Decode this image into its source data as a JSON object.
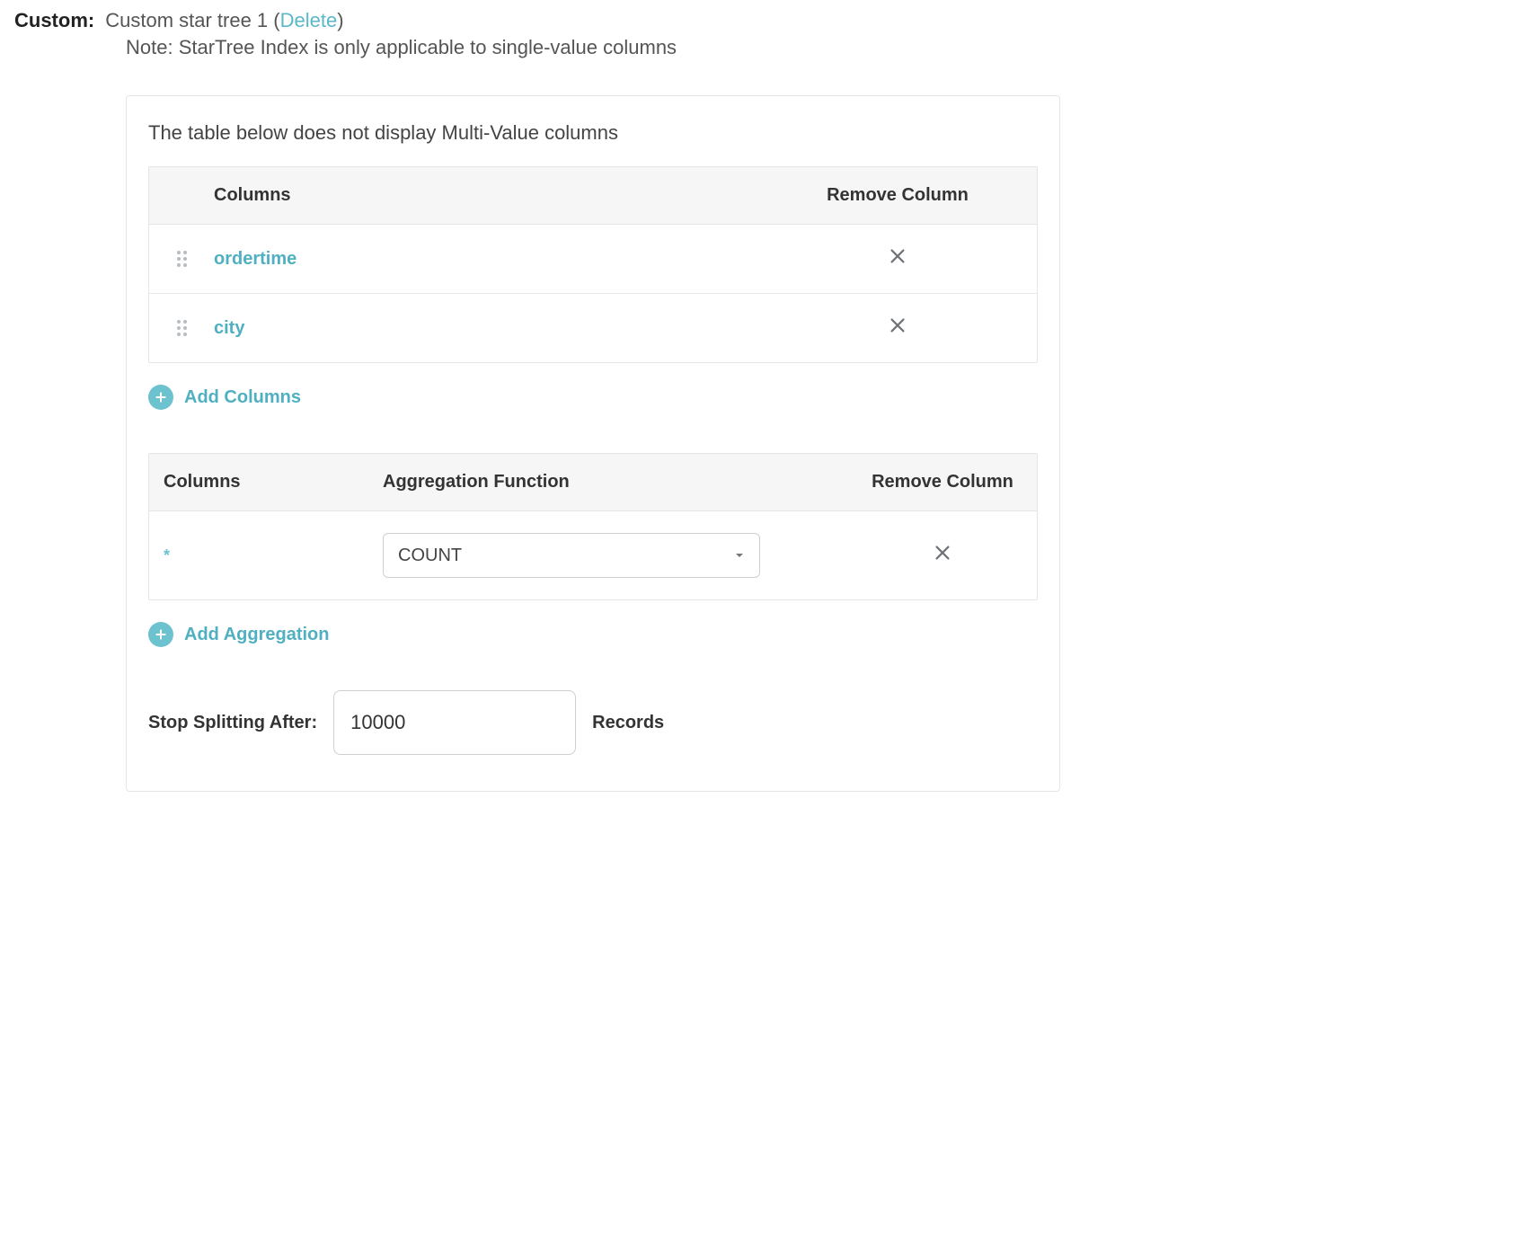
{
  "header": {
    "custom_label": "Custom:",
    "title_prefix": "Custom star tree 1 (",
    "delete_text": "Delete",
    "title_suffix": ")",
    "note": "Note: StarTree Index is only applicable to single-value columns"
  },
  "panel": {
    "description": "The table below does not display Multi-Value columns"
  },
  "columns_table": {
    "headers": {
      "columns": "Columns",
      "remove": "Remove Column"
    },
    "rows": [
      {
        "name": "ordertime"
      },
      {
        "name": "city"
      }
    ]
  },
  "add_columns_label": "Add Columns",
  "agg_table": {
    "headers": {
      "columns": "Columns",
      "agg": "Aggregation Function",
      "remove": "Remove Column"
    },
    "rows": [
      {
        "column": "*",
        "function": "COUNT"
      }
    ]
  },
  "add_aggregation_label": "Add Aggregation",
  "stop": {
    "label": "Stop Splitting After:",
    "value": "10000",
    "unit": "Records"
  }
}
